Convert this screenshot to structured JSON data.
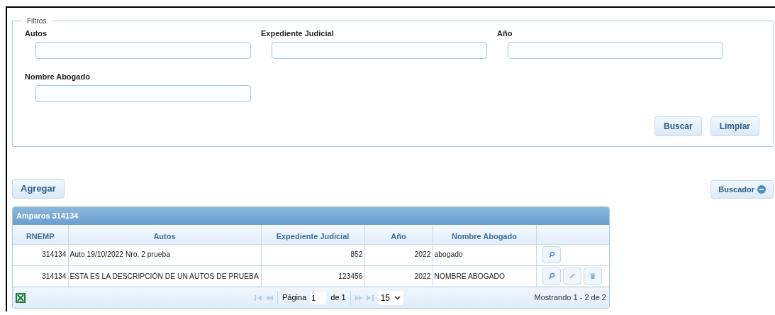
{
  "filters": {
    "legend": "Filtros",
    "fields": [
      {
        "label": "Autos"
      },
      {
        "label": "Expediente Judicial"
      },
      {
        "label": "Año"
      },
      {
        "label": "Nombre Abogado"
      }
    ],
    "buttons": [
      "Buscar",
      "Limpiar"
    ]
  },
  "add_button": "Agregar",
  "toggle_button": "Buscador",
  "table": {
    "title": "Amparos 314134",
    "columns": [
      "RNEMP",
      "Autos",
      "Expediente Judicial",
      "Año",
      "Nombre Abogado"
    ],
    "rows": [
      {
        "cells": [
          "314134",
          "Auto 19/10/2022 Nro. 2 prueba",
          "852",
          "2022",
          "abogado"
        ],
        "actions": [
          {
            "kind": "view"
          }
        ]
      },
      {
        "cells": [
          "314134",
          "ESTA ES LA DESCRIPCIÓN DE UN AUTOS DE PRUEBA",
          "123456",
          "2022",
          "NOMBRE ABOGADO"
        ],
        "actions": [
          {
            "kind": "view"
          },
          {
            "kind": "edit"
          },
          {
            "kind": "delete"
          }
        ]
      }
    ]
  },
  "pager": {
    "page_label": "Página",
    "page": "1",
    "of_label": "de 1",
    "page_size": "15",
    "status": "Mostrando 1 - 2 de 2"
  }
}
